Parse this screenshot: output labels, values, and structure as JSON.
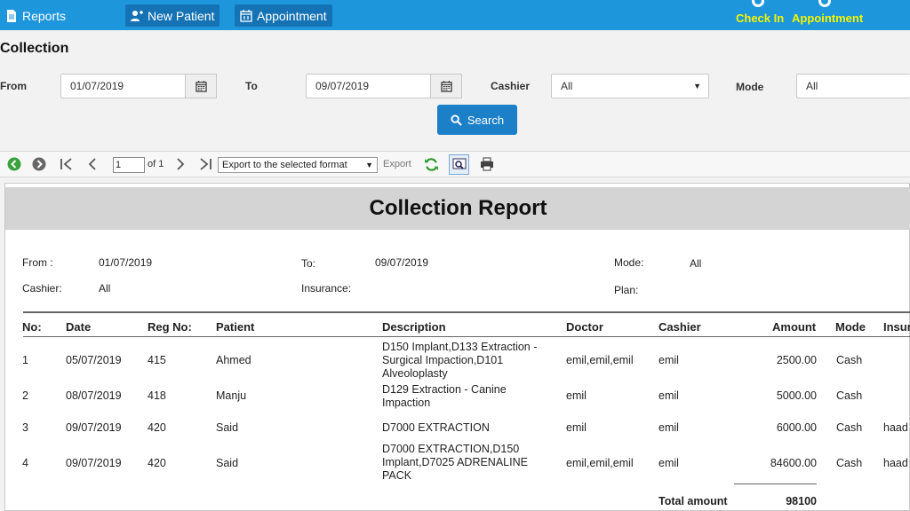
{
  "nav": {
    "reports": "Reports",
    "new_patient": "New Patient",
    "appointment": "Appointment",
    "check_in": "Check In",
    "appointment_right": "Appointment"
  },
  "page_title": "Collection",
  "filters": {
    "from_label": "From",
    "from_value": "01/07/2019",
    "to_label": "To",
    "to_value": "09/07/2019",
    "cashier_label": "Cashier",
    "cashier_value": "All",
    "mode_label": "Mode",
    "mode_value": "All",
    "search_label": "Search"
  },
  "toolbar": {
    "page_value": "1",
    "of_label": "of 1",
    "export_select": "Export to the selected format",
    "export_label": "Export"
  },
  "report": {
    "title": "Collection Report",
    "from_label": "From :",
    "from_value": "01/07/2019",
    "to_label": "To:",
    "to_value": "09/07/2019",
    "mode_label": "Mode:",
    "mode_value": "All",
    "cashier_label": "Cashier:",
    "cashier_value": "All",
    "insurance_label": "Insurance:",
    "plan_label": "Plan:",
    "columns": [
      "No:",
      "Date",
      "Reg No:",
      "Patient",
      "Description",
      "Doctor",
      "Cashier",
      "Amount",
      "Mode",
      "Insur"
    ],
    "rows": [
      {
        "no": "1",
        "date": "05/07/2019",
        "reg": "415",
        "patient": "Ahmed",
        "desc": "D150 Implant,D133 Extraction - Surgical Impaction,D101 Alveoloplasty",
        "doctor": "emil,emil,emil",
        "cashier": "emil",
        "amount": "2500.00",
        "mode": "Cash",
        "ins": ""
      },
      {
        "no": "2",
        "date": "08/07/2019",
        "reg": "418",
        "patient": "Manju",
        "desc": "D129 Extraction - Canine Impaction",
        "doctor": "emil",
        "cashier": "emil",
        "amount": "5000.00",
        "mode": "Cash",
        "ins": ""
      },
      {
        "no": "3",
        "date": "09/07/2019",
        "reg": "420",
        "patient": "Said",
        "desc": "D7000 EXTRACTION",
        "doctor": "emil",
        "cashier": "emil",
        "amount": "6000.00",
        "mode": "Cash",
        "ins": "haad"
      },
      {
        "no": "4",
        "date": "09/07/2019",
        "reg": "420",
        "patient": "Said",
        "desc": "D7000 EXTRACTION,D150 Implant,D7025 ADRENALINE PACK",
        "doctor": "emil,emil,emil",
        "cashier": "emil",
        "amount": "84600.00",
        "mode": "Cash",
        "ins": "haad"
      }
    ],
    "total_label": "Total amount",
    "total_value": "98100"
  }
}
